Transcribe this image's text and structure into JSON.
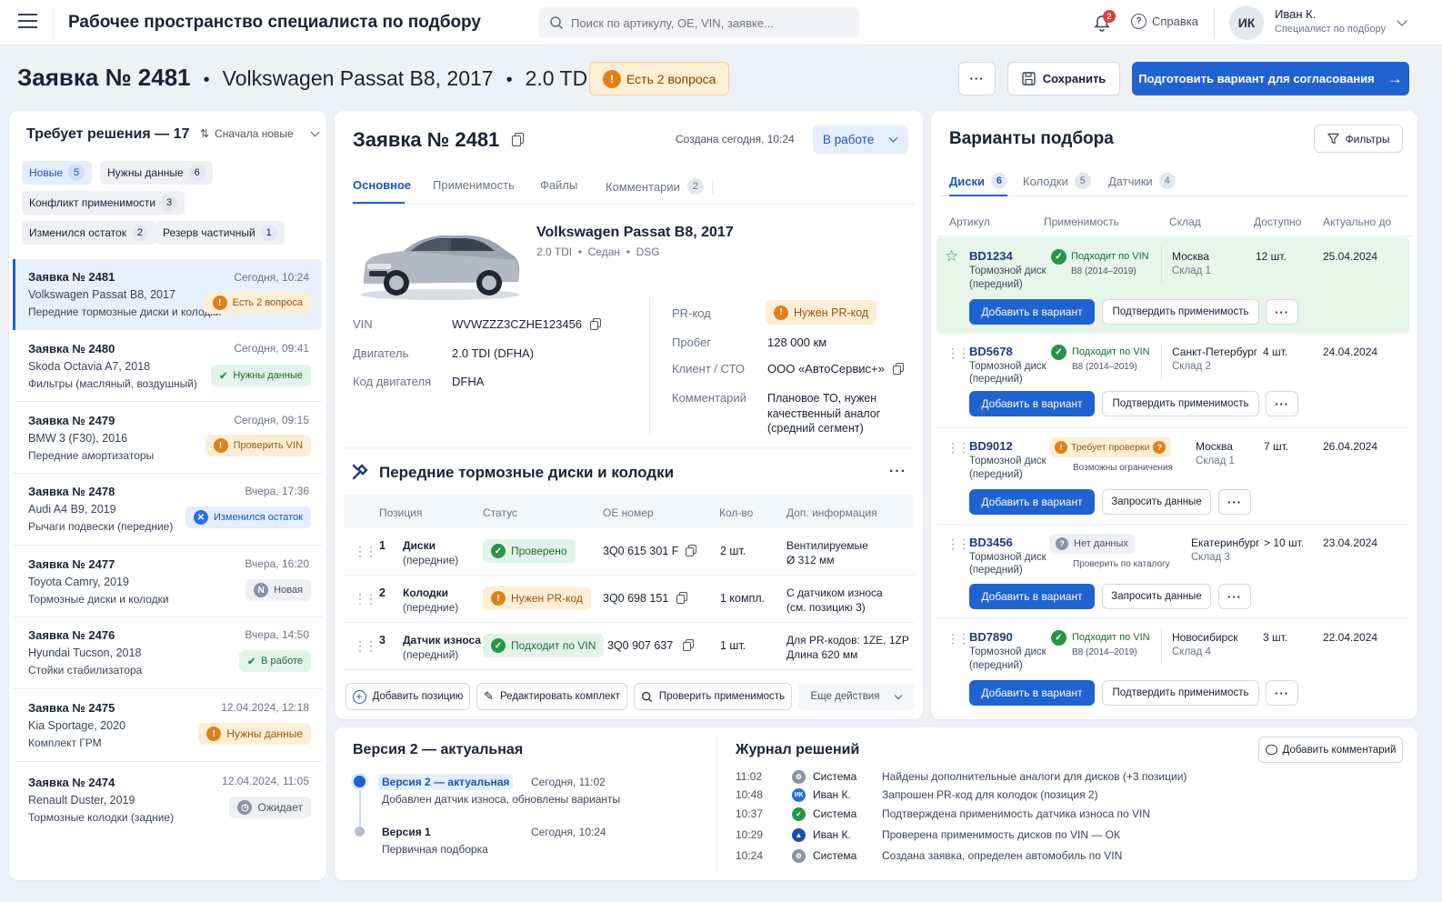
{
  "header": {
    "title": "Рабочее пространство специалиста по подбору",
    "search_placeholder": "Поиск по артикулу, OE, VIN, заявке...",
    "notif_count": "2",
    "help": "Справка",
    "user_initials": "ИК",
    "user_name": "Иван К.",
    "user_role": "Специалист по подбору"
  },
  "page": {
    "title": "Заявка № 2481",
    "car": "Volkswagen Passat B8, 2017",
    "engine": "2.0 TDI",
    "sep": "•",
    "questions_badge": "Есть 2 вопроса",
    "more": "···",
    "save": "Сохранить",
    "prepare": "Подготовить вариант для согласования"
  },
  "left": {
    "title": "Требует решения — 17",
    "sort": "Сначала новые",
    "filters": [
      {
        "label": "Новые",
        "count": "5"
      },
      {
        "label": "Нужны данные",
        "count": "6"
      },
      {
        "label": "Конфликт применимости",
        "count": "3"
      },
      {
        "label": "Изменился остаток",
        "count": "2"
      },
      {
        "label": "Резерв частичный",
        "count": "1"
      }
    ],
    "requests": [
      {
        "title": "Заявка № 2481",
        "time": "Сегодня, 10:24",
        "car": "Volkswagen Passat B8, 2017",
        "desc": "Передние тормозные диски и колодки",
        "badge": "Есть 2 вопроса"
      },
      {
        "title": "Заявка № 2480",
        "time": "Сегодня, 09:41",
        "car": "Skoda Octavia A7, 2018",
        "desc": "Фильтры (масляный, воздушный)",
        "badge": "Нужны данные"
      },
      {
        "title": "Заявка № 2479",
        "time": "Сегодня, 09:15",
        "car": "BMW 3 (F30), 2016",
        "desc": "Передние амортизаторы",
        "badge": "Проверить VIN"
      },
      {
        "title": "Заявка № 2478",
        "time": "Вчера, 17:36",
        "car": "Audi A4 B9, 2019",
        "desc": "Рычаги подвески (передние)",
        "badge": "Изменился остаток"
      },
      {
        "title": "Заявка № 2477",
        "time": "Вчера, 16:20",
        "car": "Toyota Camry, 2019",
        "desc": "Тормозные диски и колодки",
        "badge": "Новая"
      },
      {
        "title": "Заявка № 2476",
        "time": "Вчера, 14:50",
        "car": "Hyundai Tucson, 2018",
        "desc": "Стойки стабилизатора",
        "badge": "В работе"
      },
      {
        "title": "Заявка № 2475",
        "time": "12.04.2024, 12:18",
        "car": "Kia Sportage, 2020",
        "desc": "Комплект ГРМ",
        "badge": "Нужны данные"
      },
      {
        "title": "Заявка № 2474",
        "time": "12.04.2024, 11:05",
        "car": "Renault Duster, 2019",
        "desc": "Тормозные колодки (задние)",
        "badge": "Ожидает"
      }
    ]
  },
  "center": {
    "title": "Заявка № 2481",
    "created": "Создана сегодня, 10:24",
    "status": "В работе",
    "tabs": [
      {
        "label": "Основное"
      },
      {
        "label": "Применимость"
      },
      {
        "label": "Файлы"
      },
      {
        "label": "Комментарии",
        "count": "2"
      }
    ],
    "car_name": "Volkswagen Passat B8, 2017",
    "car_sub": "2.0 TDI  •  Седан  •  DSG",
    "vin_label": "VIN",
    "vin": "WVWZZZ3CZHE123456",
    "engine_label": "Двигатель",
    "engine": "2.0 TDI (DFHA)",
    "code_label": "Код двигателя",
    "code": "DFHA",
    "pr_label": "PR-код",
    "pr_badge": "Нужен PR-код",
    "mileage_label": "Пробег",
    "mileage": "128 000 км",
    "client_label": "Клиент / СТО",
    "client": "ООО «АвтоСервис+»",
    "comment_label": "Комментарий",
    "comment": "Плановое ТО, нужен качественный аналог (средний сегмент)",
    "section_title": "Передние тормозные диски и колодки",
    "cols": [
      "Позиция",
      "Статус",
      "OE номер",
      "Кол-во",
      "Доп. информация"
    ],
    "rows": [
      {
        "n": "1",
        "pos": "Диски",
        "pos2": "(передние)",
        "status": "Проверено",
        "oe": "3Q0 615 301 F",
        "qty": "2 шт.",
        "info": "Вентилируемые",
        "info2": "Ø 312 мм"
      },
      {
        "n": "2",
        "pos": "Колодки",
        "pos2": "(передние)",
        "status": "Нужен PR-код",
        "oe": "3Q0 698 151",
        "qty": "1 компл.",
        "info": "С датчиком износа",
        "info2": "(см. позицию 3)"
      },
      {
        "n": "3",
        "pos": "Датчик износа",
        "pos2": "(передний)",
        "status": "Подходит по VIN",
        "oe": "3Q0 907 637",
        "qty": "1 шт.",
        "info": "Для PR-кодов: 1ZE, 1ZP",
        "info2": "Длина 620 мм"
      }
    ],
    "actions": [
      "Добавить позицию",
      "Редактировать комплект",
      "Проверить применимость",
      "Еще действия"
    ]
  },
  "right": {
    "title": "Варианты подбора",
    "filters": "Фильтры",
    "tabs": [
      {
        "label": "Диски",
        "count": "6"
      },
      {
        "label": "Колодки",
        "count": "5"
      },
      {
        "label": "Датчики",
        "count": "4"
      }
    ],
    "cols": [
      "Артикул",
      "Применимость",
      "Склад",
      "Доступно",
      "Актуально до"
    ],
    "items": [
      {
        "sku": "BD1234",
        "name": "Тормозной диск",
        "name2": "(передний)",
        "app": "Подходит по VIN",
        "app2": "B8 (2014–2019)",
        "city": "Москва",
        "wh": "Склад 1",
        "qty": "12 шт.",
        "date": "25.04.2024",
        "add": "Добавить в вариант",
        "action": "Подтвердить применимость"
      },
      {
        "sku": "BD5678",
        "name": "Тормозной диск",
        "name2": "(передний)",
        "app": "Подходит по VIN",
        "app2": "B8 (2014–2019)",
        "city": "Санкт-Петербург",
        "wh": "Склад 2",
        "qty": "4 шт.",
        "date": "24.04.2024",
        "add": "Добавить в вариант",
        "action": "Подтвердить применимость"
      },
      {
        "sku": "BD9012",
        "name": "Тормозной диск",
        "name2": "(передний)",
        "app": "Требует проверки",
        "app2": "Возможны ограничения",
        "city": "Москва",
        "wh": "Склад 1",
        "qty": "7 шт.",
        "date": "26.04.2024",
        "add": "Добавить в вариант",
        "action": "Запросить данные"
      },
      {
        "sku": "BD3456",
        "name": "Тормозной диск",
        "name2": "(передний)",
        "app": "Нет данных",
        "app2": "Проверить по каталогу",
        "city": "Екатеринбург",
        "wh": "Склад 3",
        "qty": "> 10 шт.",
        "date": "23.04.2024",
        "add": "Добавить в вариант",
        "action": "Запросить данные"
      },
      {
        "sku": "BD7890",
        "name": "Тормозной диск",
        "name2": "(передний)",
        "app": "Подходит по VIN",
        "app2": "B8 (2014–2019)",
        "city": "Новосибирск",
        "wh": "Склад 4",
        "qty": "3 шт.",
        "date": "22.04.2024",
        "add": "Добавить в вариант",
        "action": "Подтвердить применимость"
      }
    ]
  },
  "versions": {
    "title": "Версия 2 — актуальная",
    "v2_label": "Версия 2 — актуальная",
    "v2_time": "Сегодня, 11:02",
    "v2_desc": "Добавлен датчик износа, обновлены варианты",
    "v1_label": "Версия 1",
    "v1_time": "Сегодня, 10:24",
    "v1_desc": "Первичная подборка"
  },
  "log": {
    "title": "Журнал решений",
    "add_comment": "Добавить комментарий",
    "entries": [
      {
        "time": "11:02",
        "who": "Система",
        "text": "Найдены дополнительные аналоги для дисков (+3 позиции)"
      },
      {
        "time": "10:48",
        "who": "Иван К.",
        "text": "Запрошен PR-код для колодок (позиция 2)"
      },
      {
        "time": "10:37",
        "who": "Система",
        "text": "Подтверждена применимость датчика износа по VIN"
      },
      {
        "time": "10:29",
        "who": "Иван К.",
        "text": "Проверена применимость дисков по VIN — ОК"
      },
      {
        "time": "10:24",
        "who": "Система",
        "text": "Создана заявка, определен автомобиль по VIN"
      }
    ]
  }
}
